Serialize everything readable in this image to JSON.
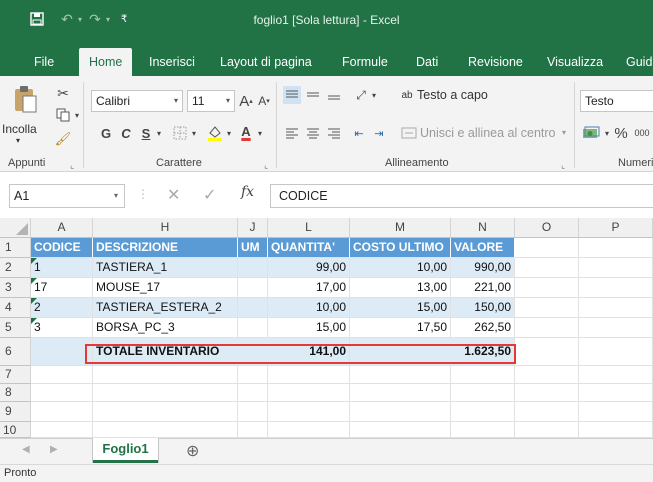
{
  "window": {
    "title": "foglio1  [Sola lettura]  -  Excel"
  },
  "qat": {
    "save_icon": "save-icon",
    "undo_icon": "undo-icon",
    "redo_icon": "redo-icon",
    "customize_icon": "customize-icon"
  },
  "tabs": [
    "File",
    "Home",
    "Inserisci",
    "Layout di pagina",
    "Formule",
    "Dati",
    "Revisione",
    "Visualizza",
    "Guid"
  ],
  "ribbon": {
    "paste_label": "Incolla",
    "font_name": "Calibri",
    "font_size": "11",
    "bold": "G",
    "italic": "C",
    "underline": "S",
    "grow_font": "A",
    "shrink_font": "A",
    "font_color": "A",
    "wrap_text_label": "Testo a capo",
    "wrap_text_icon_text": "ab",
    "merge_center_label": "Unisci e allinea al centro",
    "number_format": "Testo",
    "percent": "%",
    "thousands": "000",
    "groups": [
      "Appunti",
      "Carattere",
      "Allineamento",
      "Numeri"
    ]
  },
  "formula_bar": {
    "name_box": "A1",
    "fx": "fx",
    "content": "CODICE"
  },
  "grid": {
    "columns": [
      "A",
      "H",
      "J",
      "L",
      "M",
      "N",
      "O",
      "P"
    ],
    "row_numbers": [
      "1",
      "2",
      "3",
      "4",
      "5",
      "6",
      "7",
      "8",
      "9",
      "10"
    ],
    "header": [
      "CODICE",
      "DESCRIZIONE",
      "UM",
      "QUANTITA'",
      "COSTO ULTIMO",
      "VALORE"
    ],
    "rows": [
      [
        "1",
        "TASTIERA_1",
        "",
        "99,00",
        "10,00",
        "990,00"
      ],
      [
        "17",
        "MOUSE_17",
        "",
        "17,00",
        "13,00",
        "221,00"
      ],
      [
        "2",
        "TASTIERA_ESTERA_2",
        "",
        "10,00",
        "15,00",
        "150,00"
      ],
      [
        "3",
        "BORSA_PC_3",
        "",
        "15,00",
        "17,50",
        "262,50"
      ]
    ],
    "total": {
      "label": "TOTALE INVENTARIO",
      "quantity": "141,00",
      "value": "1.623,50"
    }
  },
  "sheets": {
    "active": "Foglio1",
    "add_icon": "⊕"
  },
  "status": {
    "text": "Pronto"
  },
  "colors": {
    "excel_green": "#217346",
    "header_blue": "#5b9bd5",
    "band_blue": "#ddebf7",
    "highlight_red": "#e53935"
  }
}
